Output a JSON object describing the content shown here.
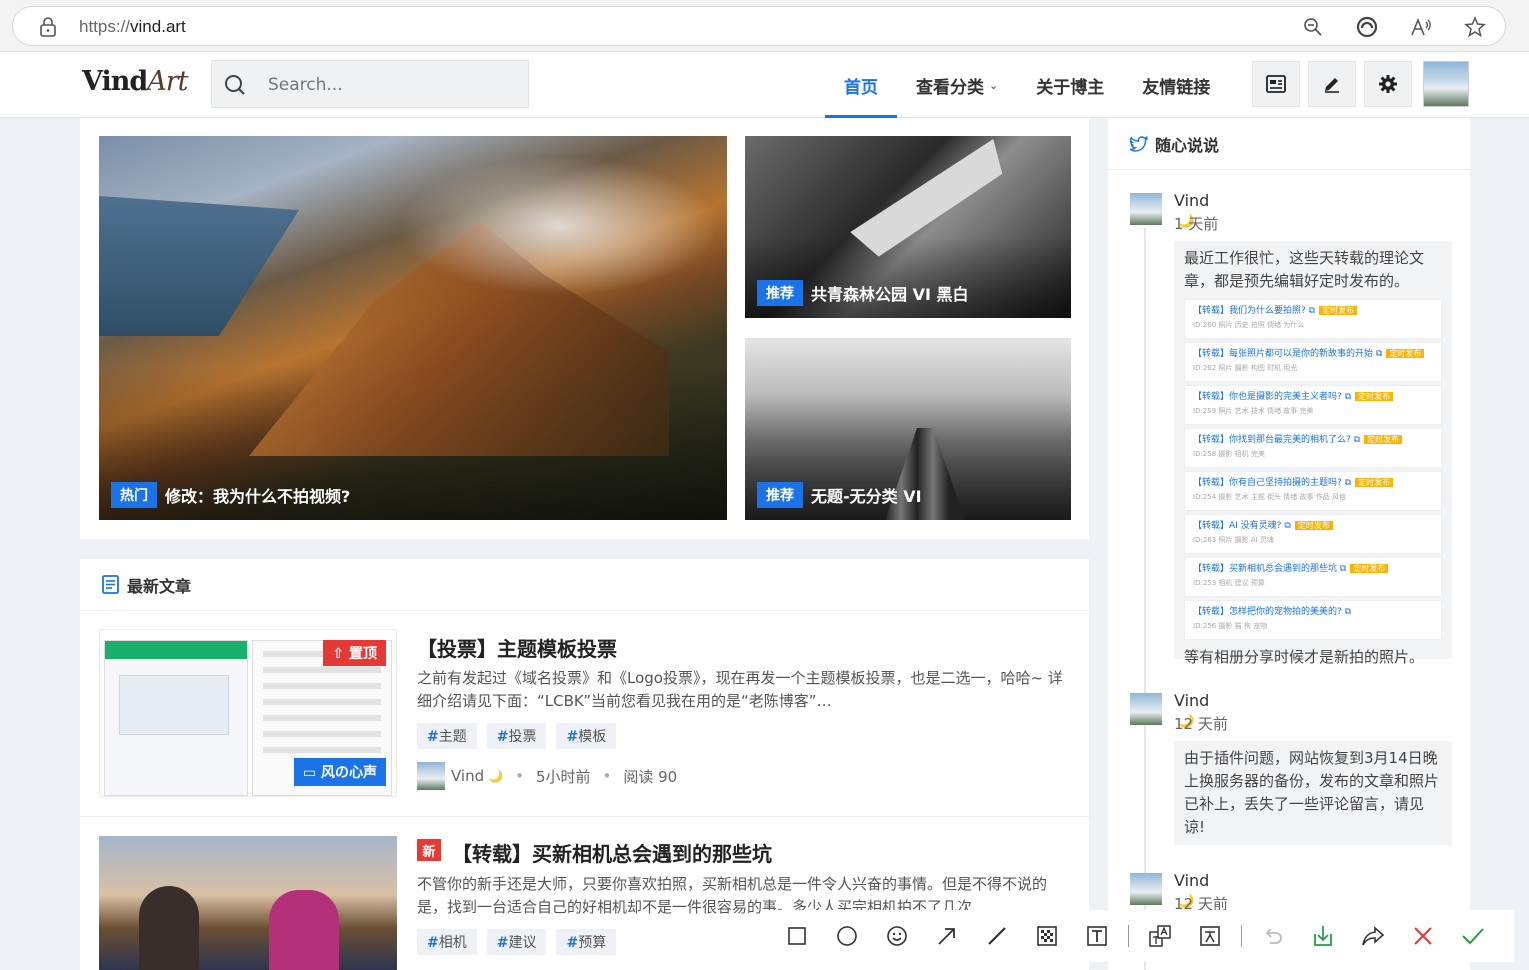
{
  "browser": {
    "url_proto": "https://",
    "url_host": "vind.art"
  },
  "header": {
    "logo_main": "Vind",
    "logo_art": "Art",
    "search_placeholder": "Search...",
    "nav": [
      {
        "label": "首页",
        "active": true
      },
      {
        "label": "查看分类",
        "dropdown": true
      },
      {
        "label": "关于博主"
      },
      {
        "label": "友情链接"
      }
    ]
  },
  "featured": [
    {
      "badge": "热门",
      "title": "修改：我为什么不拍视频?"
    },
    {
      "badge": "推荐",
      "title": "共青森林公园 VI 黑白"
    },
    {
      "badge": "推荐",
      "title": "无题-无分类 VI"
    }
  ],
  "latest": {
    "heading": "最新文章",
    "posts": [
      {
        "pin_badge": "置顶",
        "category": "风の心声",
        "title": "【投票】主题模板投票",
        "excerpt": "之前有发起过《域名投票》和《Logo投票》，现在再发一个主题模板投票，也是二选一，哈哈~ 详细介绍请见下面：“LCBK”当前您看见我在用的是“老陈博客”…",
        "tags": [
          "主题",
          "投票",
          "模板"
        ],
        "author": "Vind",
        "time": "5小时前",
        "reads": "阅读 90"
      },
      {
        "new_badge": "新",
        "title": "【转载】买新相机总会遇到的那些坑",
        "excerpt": "不管你的新手还是大师，只要你喜欢拍照，买新相机总是一件令人兴奋的事情。但是不得不说的是，找到一台适合自己的好相机却不是一件很容易的事。多少人买完相机拍不了几次",
        "tags": [
          "相机",
          "建议",
          "预算"
        ]
      }
    ]
  },
  "sidebar": {
    "heading": "随心说说",
    "tweets": [
      {
        "name": "Vind",
        "time": "1 天前",
        "text_before": "最近工作很忙，这些天转载的理论文章，都是预先编辑好定时发布的。",
        "list": [
          {
            "title": "【转载】我们为什么要拍照?",
            "meta": "ID:260 照片 历史 拍照 情绪 为什么"
          },
          {
            "title": "【转载】每张照片都可以是你的新故事的开始",
            "meta": "ID:262 照片 摄影 构图 时机 用光"
          },
          {
            "title": "【转载】你也是摄影的完美主义者吗?",
            "meta": "ID:259 照片 艺术 技术 情绪 故事 完美"
          },
          {
            "title": "【转载】你找到那台最完美的相机了么?",
            "meta": "ID:258 摄影 相机 完美"
          },
          {
            "title": "【转载】你有自己坚持拍摄的主题吗?",
            "meta": "ID:254 摄影 艺术 主题 街头 情绪 故事 作品 风格"
          },
          {
            "title": "【转载】AI 没有灵魂?",
            "meta": "ID:263 照片 摄影 AI 灵魂"
          },
          {
            "title": "【转载】买新相机总会遇到的那些坑",
            "meta": "ID:253 相机 建议 预算"
          },
          {
            "title": "【转载】怎样把你的宠物拍的美美的?",
            "meta": "ID:256 摄影 猫 狗 宠物"
          }
        ],
        "list_badge": "定时发布",
        "text_after": "等有相册分享时候才是新拍的照片。"
      },
      {
        "name": "Vind",
        "time": "12 天前",
        "text": "由于插件问题，网站恢复到3月14日晚上换服务器的备份，发布的文章和照片已补上，丢失了一些评论留言，请见谅!"
      },
      {
        "name": "Vind",
        "time": "12 天前"
      }
    ]
  }
}
